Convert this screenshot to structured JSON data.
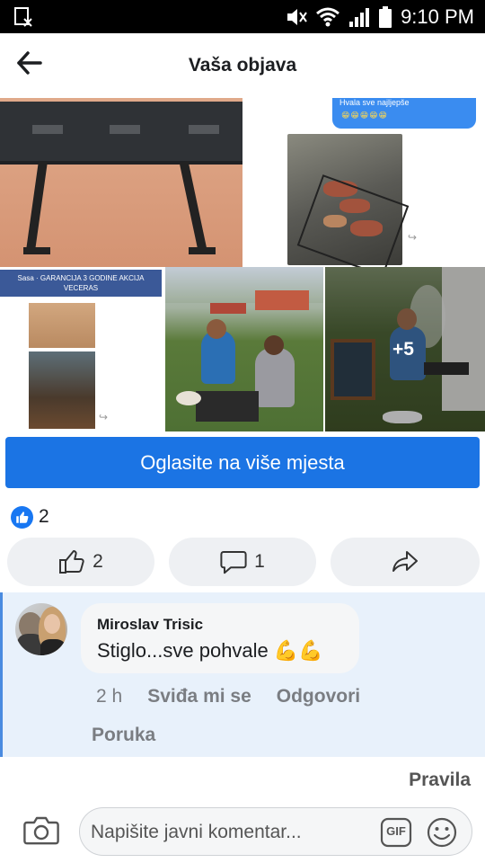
{
  "status_bar": {
    "time": "9:10 PM",
    "icons": [
      "screenshot-icon",
      "mute-icon",
      "wifi-icon",
      "signal-icon",
      "battery-icon"
    ]
  },
  "header": {
    "title": "Vaša objava",
    "back_icon": "arrow-left-icon"
  },
  "photos": {
    "screenshot_header": "Sasa · GARANCIJA 3 GODINE AKCIJA VECERAS",
    "chat_snippet": "Hvala sve najljepše",
    "more_count": "+5"
  },
  "promote": {
    "label": "Oglasite na više mjesta"
  },
  "reactions": {
    "summary_count": "2",
    "like_count": "2",
    "comment_count": "1",
    "icons": [
      "like-icon",
      "comment-icon",
      "share-icon"
    ]
  },
  "comment": {
    "author": "Miroslav Trisic",
    "text": "Stiglo...sve pohvale 💪💪",
    "time": "2 h",
    "like_action": "Sviđa mi se",
    "reply_action": "Odgovori",
    "message_action": "Poruka"
  },
  "rules_link": "Pravila",
  "composer": {
    "placeholder": "Napišite javni komentar...",
    "gif_label": "GIF"
  },
  "colors": {
    "accent": "#1b74e4",
    "comment_highlight": "#e8f1fb",
    "status_bar": "#000000"
  }
}
